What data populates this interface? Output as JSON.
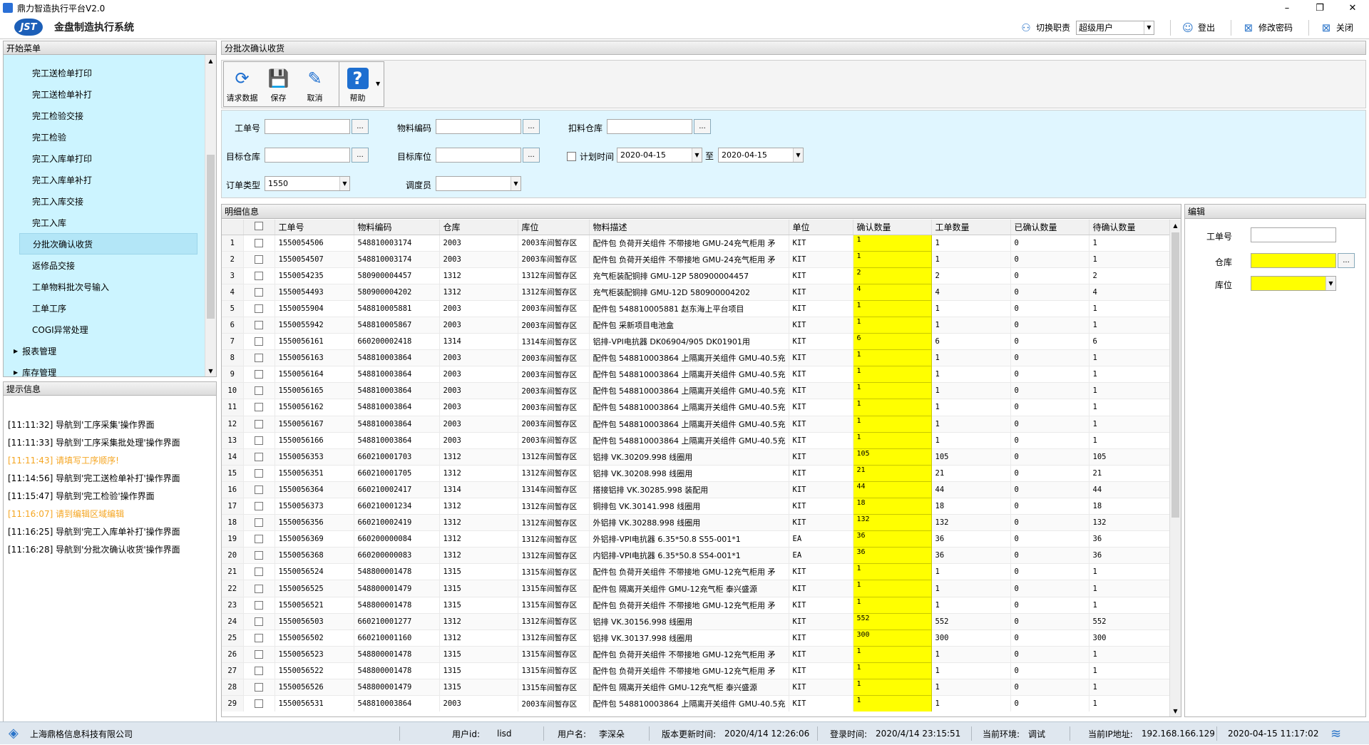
{
  "window": {
    "title": "鼎力智造执行平台V2.0",
    "minimize": "–",
    "maximize": "❐",
    "close": "✕"
  },
  "header": {
    "logo": "JST",
    "system_name": "金盘制造执行系统",
    "switch_role": "切换职责",
    "role_value": "超级用户",
    "logout": "登出",
    "change_password": "修改密码",
    "close": "关闭"
  },
  "sidebar": {
    "title": "开始菜单",
    "items": [
      {
        "label": "完工送检单打印"
      },
      {
        "label": "完工送检单补打"
      },
      {
        "label": "完工检验交接"
      },
      {
        "label": "完工检验"
      },
      {
        "label": "完工入库单打印"
      },
      {
        "label": "完工入库单补打"
      },
      {
        "label": "完工入库交接"
      },
      {
        "label": "完工入库"
      },
      {
        "label": "分批次确认收货"
      },
      {
        "label": "返修品交接"
      },
      {
        "label": "工单物料批次号输入"
      },
      {
        "label": "工单工序"
      },
      {
        "label": "COGI异常处理"
      },
      {
        "label": "报表管理"
      },
      {
        "label": "库存管理"
      }
    ]
  },
  "log": {
    "title": "提示信息",
    "lines": [
      {
        "text": "[11:11:32] 导航到'工序采集'操作界面",
        "warn": false
      },
      {
        "text": "[11:11:33] 导航到'工序采集批处理'操作界面",
        "warn": false
      },
      {
        "text": "[11:11:43] 请填写工序顺序!",
        "warn": true
      },
      {
        "text": "[11:14:56] 导航到'完工送检单补打'操作界面",
        "warn": false
      },
      {
        "text": "[11:15:47] 导航到'完工检验'操作界面",
        "warn": false
      },
      {
        "text": "[11:16:07] 请到编辑区域编辑",
        "warn": true
      },
      {
        "text": "[11:16:25] 导航到'完工入库单补打'操作界面",
        "warn": false
      },
      {
        "text": "[11:16:28] 导航到'分批次确认收货'操作界面",
        "warn": false
      }
    ]
  },
  "main": {
    "title": "分批次确认收货",
    "toolbar": {
      "request": "请求数据",
      "save": "保存",
      "cancel": "取消",
      "help": "帮助"
    },
    "filter": {
      "work_order": "工单号",
      "material_code": "物料编码",
      "deduct_warehouse": "扣料仓库",
      "target_warehouse": "目标仓库",
      "target_location": "目标库位",
      "plan_time": "计划时间",
      "date_from": "2020-04-15",
      "to": "至",
      "date_to": "2020-04-15",
      "order_type": "订单类型",
      "order_type_value": "1550",
      "dispatcher": "调度员",
      "ellipsis": "..."
    }
  },
  "detail": {
    "title": "明细信息",
    "columns": [
      "工单号",
      "物料编码",
      "仓库",
      "库位",
      "物料描述",
      "单位",
      "确认数量",
      "工单数量",
      "已确认数量",
      "待确认数量"
    ],
    "rows": [
      [
        "1550054506",
        "548810003174",
        "2003",
        "2003车间暂存区",
        "配件包 负荷开关组件 不带接地 GMU-24充气柜用 矛",
        "KIT",
        "1",
        "1",
        "0",
        "1"
      ],
      [
        "1550054507",
        "548810003174",
        "2003",
        "2003车间暂存区",
        "配件包 负荷开关组件 不带接地 GMU-24充气柜用 矛",
        "KIT",
        "1",
        "1",
        "0",
        "1"
      ],
      [
        "1550054235",
        "580900004457",
        "1312",
        "1312车间暂存区",
        "充气柜装配铜排 GMU-12P 580900004457",
        "KIT",
        "2",
        "2",
        "0",
        "2"
      ],
      [
        "1550054493",
        "580900004202",
        "1312",
        "1312车间暂存区",
        "充气柜装配铜排 GMU-12D 580900004202",
        "KIT",
        "4",
        "4",
        "0",
        "4"
      ],
      [
        "1550055904",
        "548810005881",
        "2003",
        "2003车间暂存区",
        "配件包 548810005881 赵东海上平台项目",
        "KIT",
        "1",
        "1",
        "0",
        "1"
      ],
      [
        "1550055942",
        "548810005867",
        "2003",
        "2003车间暂存区",
        "配件包 采新项目电池盒",
        "KIT",
        "1",
        "1",
        "0",
        "1"
      ],
      [
        "1550056161",
        "660200002418",
        "1314",
        "1314车间暂存区",
        "铝排-VPI电抗器 DK06904/905 DK01901用",
        "KIT",
        "6",
        "6",
        "0",
        "6"
      ],
      [
        "1550056163",
        "548810003864",
        "2003",
        "2003车间暂存区",
        "配件包 548810003864 上隔离开关组件 GMU-40.5充",
        "KIT",
        "1",
        "1",
        "0",
        "1"
      ],
      [
        "1550056164",
        "548810003864",
        "2003",
        "2003车间暂存区",
        "配件包 548810003864 上隔离开关组件 GMU-40.5充",
        "KIT",
        "1",
        "1",
        "0",
        "1"
      ],
      [
        "1550056165",
        "548810003864",
        "2003",
        "2003车间暂存区",
        "配件包 548810003864 上隔离开关组件 GMU-40.5充",
        "KIT",
        "1",
        "1",
        "0",
        "1"
      ],
      [
        "1550056162",
        "548810003864",
        "2003",
        "2003车间暂存区",
        "配件包 548810003864 上隔离开关组件 GMU-40.5充",
        "KIT",
        "1",
        "1",
        "0",
        "1"
      ],
      [
        "1550056167",
        "548810003864",
        "2003",
        "2003车间暂存区",
        "配件包 548810003864 上隔离开关组件 GMU-40.5充",
        "KIT",
        "1",
        "1",
        "0",
        "1"
      ],
      [
        "1550056166",
        "548810003864",
        "2003",
        "2003车间暂存区",
        "配件包 548810003864 上隔离开关组件 GMU-40.5充",
        "KIT",
        "1",
        "1",
        "0",
        "1"
      ],
      [
        "1550056353",
        "660210001703",
        "1312",
        "1312车间暂存区",
        "铝排 VK.30209.998 线圈用",
        "KIT",
        "105",
        "105",
        "0",
        "105"
      ],
      [
        "1550056351",
        "660210001705",
        "1312",
        "1312车间暂存区",
        "铝排 VK.30208.998 线圈用",
        "KIT",
        "21",
        "21",
        "0",
        "21"
      ],
      [
        "1550056364",
        "660210002417",
        "1314",
        "1314车间暂存区",
        "搭接铝排 VK.30285.998 装配用",
        "KIT",
        "44",
        "44",
        "0",
        "44"
      ],
      [
        "1550056373",
        "660210001234",
        "1312",
        "1312车间暂存区",
        "铜排包 VK.30141.998 线圈用",
        "KIT",
        "18",
        "18",
        "0",
        "18"
      ],
      [
        "1550056356",
        "660210002419",
        "1312",
        "1312车间暂存区",
        "外铝排 VK.30288.998 线圈用",
        "KIT",
        "132",
        "132",
        "0",
        "132"
      ],
      [
        "1550056369",
        "660200000084",
        "1312",
        "1312车间暂存区",
        "外铝排-VPI电抗器 6.35*50.8 S55-001*1",
        "EA",
        "36",
        "36",
        "0",
        "36"
      ],
      [
        "1550056368",
        "660200000083",
        "1312",
        "1312车间暂存区",
        "内铝排-VPI电抗器 6.35*50.8 S54-001*1",
        "EA",
        "36",
        "36",
        "0",
        "36"
      ],
      [
        "1550056524",
        "548800001478",
        "1315",
        "1315车间暂存区",
        "配件包 负荷开关组件 不带接地 GMU-12充气柜用 矛",
        "KIT",
        "1",
        "1",
        "0",
        "1"
      ],
      [
        "1550056525",
        "548800001479",
        "1315",
        "1315车间暂存区",
        "配件包 隔离开关组件 GMU-12充气柜 泰兴盛源",
        "KIT",
        "1",
        "1",
        "0",
        "1"
      ],
      [
        "1550056521",
        "548800001478",
        "1315",
        "1315车间暂存区",
        "配件包 负荷开关组件 不带接地 GMU-12充气柜用 矛",
        "KIT",
        "1",
        "1",
        "0",
        "1"
      ],
      [
        "1550056503",
        "660210001277",
        "1312",
        "1312车间暂存区",
        "铝排 VK.30156.998 线圈用",
        "KIT",
        "552",
        "552",
        "0",
        "552"
      ],
      [
        "1550056502",
        "660210001160",
        "1312",
        "1312车间暂存区",
        "铝排 VK.30137.998 线圈用",
        "KIT",
        "300",
        "300",
        "0",
        "300"
      ],
      [
        "1550056523",
        "548800001478",
        "1315",
        "1315车间暂存区",
        "配件包 负荷开关组件 不带接地 GMU-12充气柜用 矛",
        "KIT",
        "1",
        "1",
        "0",
        "1"
      ],
      [
        "1550056522",
        "548800001478",
        "1315",
        "1315车间暂存区",
        "配件包 负荷开关组件 不带接地 GMU-12充气柜用 矛",
        "KIT",
        "1",
        "1",
        "0",
        "1"
      ],
      [
        "1550056526",
        "548800001479",
        "1315",
        "1315车间暂存区",
        "配件包 隔离开关组件 GMU-12充气柜 泰兴盛源",
        "KIT",
        "1",
        "1",
        "0",
        "1"
      ],
      [
        "1550056531",
        "548810003864",
        "2003",
        "2003车间暂存区",
        "配件包 548810003864 上隔离开关组件 GMU-40.5充",
        "KIT",
        "1",
        "1",
        "0",
        "1"
      ]
    ]
  },
  "edit": {
    "title": "编辑",
    "work_order": "工单号",
    "warehouse": "仓库",
    "location": "库位",
    "ellipsis": "..."
  },
  "status": {
    "company": "上海鼎格信息科技有限公司",
    "user_id_label": "用户id:",
    "user_id": "lisd",
    "user_name_label": "用户名:",
    "user_name": "李深朵",
    "version_label": "版本更新时间:",
    "version": "2020/4/14 12:26:06",
    "login_label": "登录时间:",
    "login": "2020/4/14 23:15:51",
    "env_label": "当前环境:",
    "env": "调试",
    "ip_label": "当前IP地址:",
    "ip": "192.168.166.129",
    "datetime": "2020-04-15 11:17:02"
  }
}
